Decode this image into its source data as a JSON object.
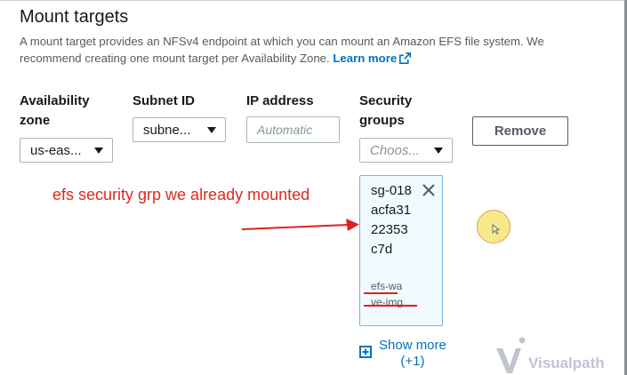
{
  "section": {
    "title": "Mount targets",
    "description": "A mount target provides an NFSv4 endpoint at which you can mount an Amazon EFS file system. We recommend creating one mount target per Availability Zone.",
    "learn_more": "Learn more"
  },
  "columns": {
    "az_label_1": "Availability",
    "az_label_2": "zone",
    "subnet_label": "Subnet ID",
    "ip_label": "IP address",
    "sg_label_1": "Security",
    "sg_label_2": "groups"
  },
  "row": {
    "az_value": "us-eas...",
    "subnet_value": "subne...",
    "ip_placeholder": "Automatic",
    "sg_placeholder": "Choos...",
    "remove_label": "Remove",
    "token": {
      "id": "sg-018acfa3122353c7d",
      "name": "efs-wave-img"
    },
    "show_more_1": "Show more",
    "show_more_2": "(+1)"
  },
  "annotation": {
    "text": "efs security grp we already mounted",
    "color": "#e0281c"
  },
  "watermark": {
    "text": "Visualpath"
  },
  "colors": {
    "link": "#0073bb",
    "token_border": "#7ab6d6",
    "token_bg": "#f1faff"
  }
}
